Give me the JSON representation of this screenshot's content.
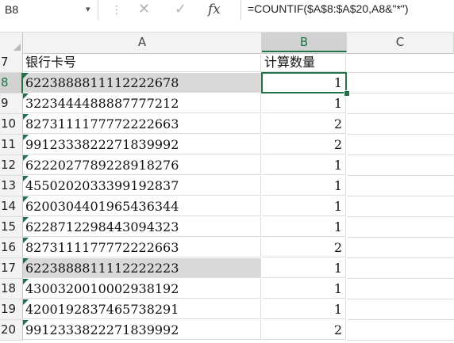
{
  "formula_bar": {
    "name_box": "B8",
    "name_box_arrow": "▾",
    "separator": "⋮",
    "cancel_glyph": "✕",
    "enter_glyph": "✓",
    "fx_glyph": "fx",
    "formula": "=COUNTIF($A$8:$A$20,A8&\"*\")"
  },
  "columns": [
    {
      "label": "A",
      "selected": false
    },
    {
      "label": "B",
      "selected": true
    },
    {
      "label": "C",
      "selected": false
    }
  ],
  "rows": [
    {
      "num": "7",
      "a": "银行卡号",
      "b": "计算数量",
      "marker": false,
      "highlight": false,
      "header": true
    },
    {
      "num": "8",
      "a": "6223888811112222678",
      "b": "1",
      "marker": true,
      "highlight": true,
      "selected": true
    },
    {
      "num": "9",
      "a": "3223444488887777212",
      "b": "1",
      "marker": true,
      "highlight": false
    },
    {
      "num": "10",
      "a": "8273111177772222663",
      "b": "2",
      "marker": true,
      "highlight": false
    },
    {
      "num": "11",
      "a": "9912333822271839992",
      "b": "2",
      "marker": true,
      "highlight": false
    },
    {
      "num": "12",
      "a": "6222027789228918276",
      "b": "1",
      "marker": true,
      "highlight": false
    },
    {
      "num": "13",
      "a": "4550202033399192837",
      "b": "1",
      "marker": true,
      "highlight": false
    },
    {
      "num": "14",
      "a": "6200304401965436344",
      "b": "1",
      "marker": true,
      "highlight": false
    },
    {
      "num": "15",
      "a": "6228712298443094323",
      "b": "1",
      "marker": true,
      "highlight": false
    },
    {
      "num": "16",
      "a": "8273111177772222663",
      "b": "2",
      "marker": true,
      "highlight": false
    },
    {
      "num": "17",
      "a": "6223888811112222223",
      "b": "1",
      "marker": true,
      "highlight": true
    },
    {
      "num": "18",
      "a": "4300320010002938192",
      "b": "1",
      "marker": true,
      "highlight": false
    },
    {
      "num": "19",
      "a": "4200192837465738291",
      "b": "1",
      "marker": true,
      "highlight": false
    },
    {
      "num": "20",
      "a": "9912333822271839992",
      "b": "2",
      "marker": true,
      "highlight": false
    }
  ],
  "colors": {
    "accent": "#217346",
    "highlight": "#d9d9d9",
    "header_bg": "#f3f3f3"
  }
}
